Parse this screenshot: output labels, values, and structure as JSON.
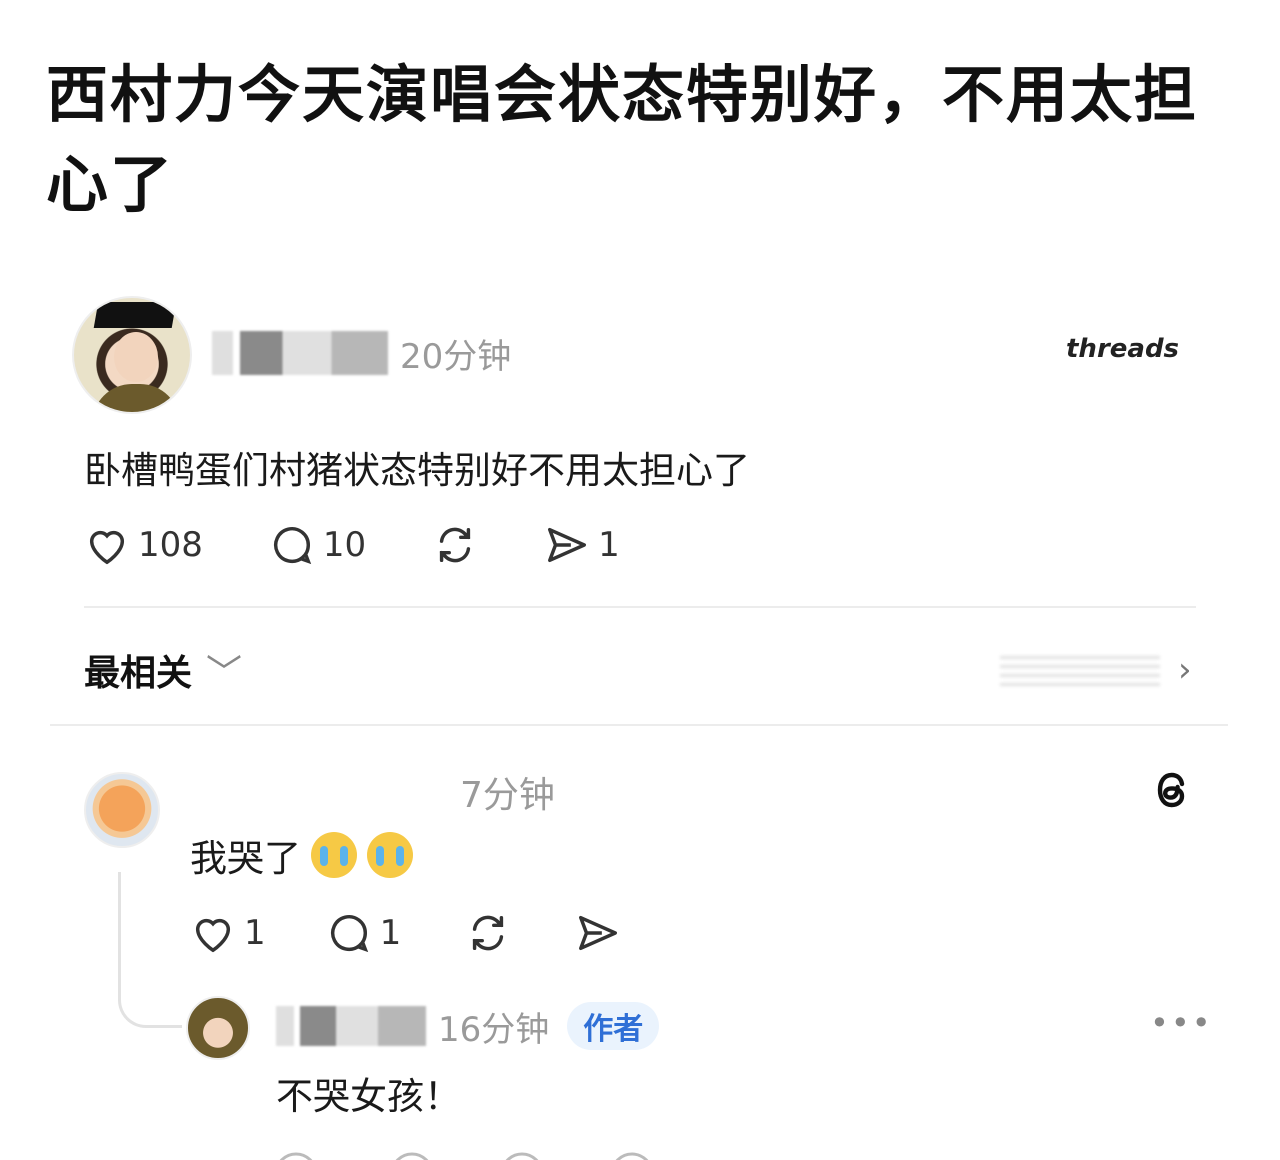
{
  "headline": "西村力今天演唱会状态特别好，不用太担心了",
  "post": {
    "time": "20分钟",
    "brand": "threads",
    "text": "卧槽鸭蛋们村猪状态特别好不用太担心了",
    "likes": "108",
    "comments": "10",
    "shares": "1"
  },
  "sort": {
    "label": "最相关",
    "chevron": "﹀"
  },
  "comment": {
    "time": "7分钟",
    "text": "我哭了",
    "likes": "1",
    "replies": "1"
  },
  "reply": {
    "time": "16分钟",
    "badge": "作者",
    "text": "不哭女孩！",
    "more": "•••"
  },
  "icons": {
    "like": "heart-icon",
    "comment": "comment-bubble-icon",
    "repost": "repost-icon",
    "share": "send-icon",
    "threads": "threads-logo-icon",
    "more": "more-icon"
  },
  "colors": {
    "badge_text": "#2f6fd6",
    "badge_bg": "#eaf3fd",
    "meta": "#9a9a9a"
  }
}
